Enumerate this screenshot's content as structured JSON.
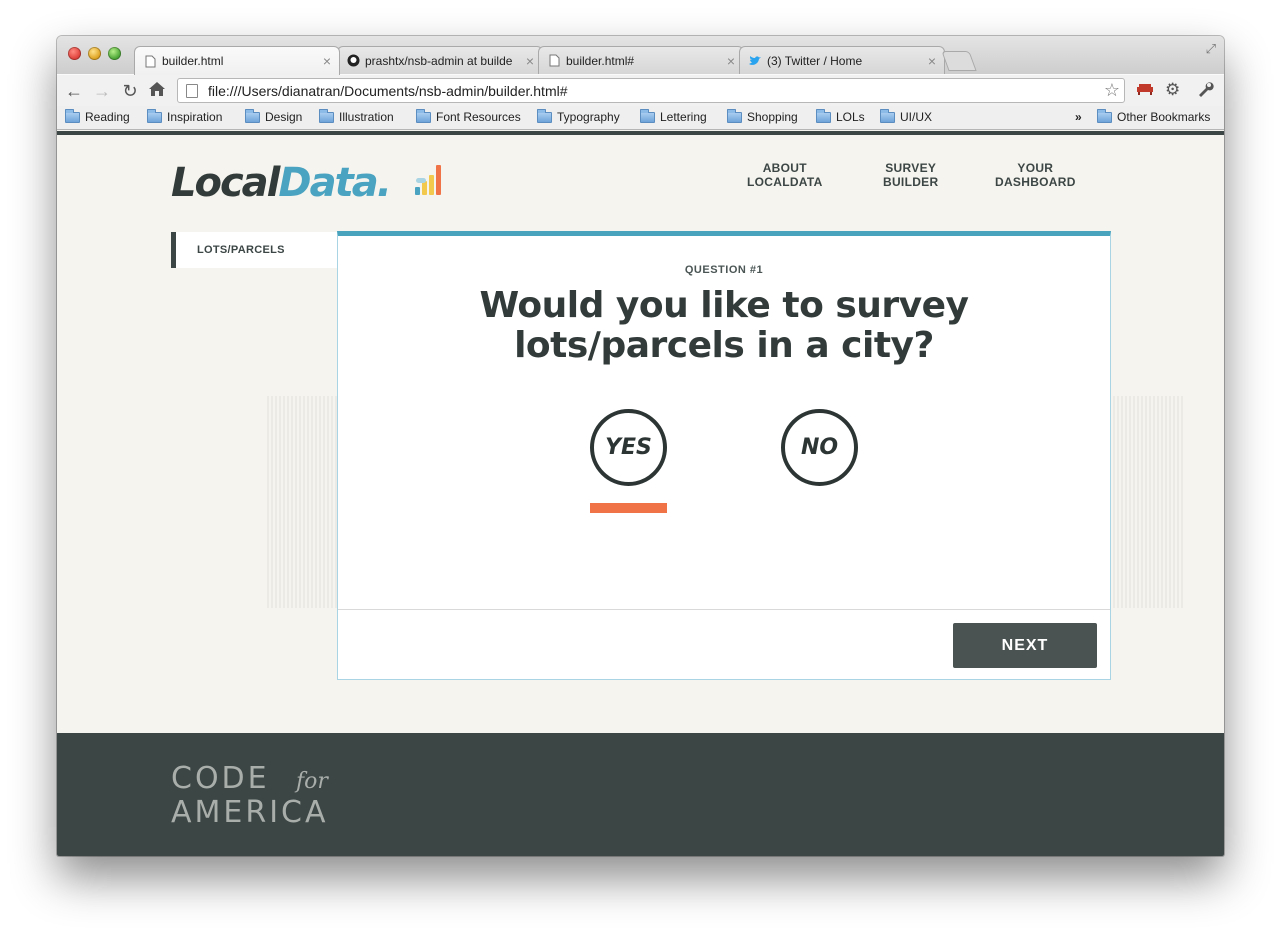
{
  "browser": {
    "tabs": [
      {
        "title": "builder.html",
        "icon": "page-icon",
        "active": true
      },
      {
        "title": "prashtx/nsb-admin at builde",
        "icon": "github-icon",
        "active": false
      },
      {
        "title": "builder.html#",
        "icon": "page-icon",
        "active": false
      },
      {
        "title": "(3) Twitter / Home",
        "icon": "twitter-icon",
        "active": false
      }
    ],
    "tab_close": "×",
    "url": "file:///Users/dianatran/Documents/nsb-admin/builder.html#",
    "bookmarks": [
      "Reading",
      "Inspiration",
      "Design",
      "Illustration",
      "Font Resources",
      "Typography",
      "Lettering",
      "Shopping",
      "LOLs",
      "UI/UX"
    ],
    "bookmarks_overflow": "»",
    "other_bookmarks": "Other Bookmarks"
  },
  "site": {
    "logo_part1": "Local",
    "logo_part2": "Data",
    "logo_dot": ".",
    "nav": [
      {
        "line1": "ABOUT",
        "line2": "LOCALDATA"
      },
      {
        "line1": "SURVEY",
        "line2": "BUILDER"
      },
      {
        "line1": "YOUR",
        "line2": "DASHBOARD"
      }
    ],
    "sidebar_item": "LOTS/PARCELS"
  },
  "survey": {
    "question_number": "QUESTION #1",
    "question_line1": "Would you like to survey",
    "question_line2": "lots/parcels in a city?",
    "yes_label": "YES",
    "no_label": "NO",
    "selected": "YES",
    "next_label": "NEXT"
  },
  "footer": {
    "line1": "CODE",
    "for": "for",
    "line2": "AMERICA"
  },
  "colors": {
    "accent": "#4aa3bd",
    "dark": "#3c4645",
    "selection": "#ef7347"
  }
}
